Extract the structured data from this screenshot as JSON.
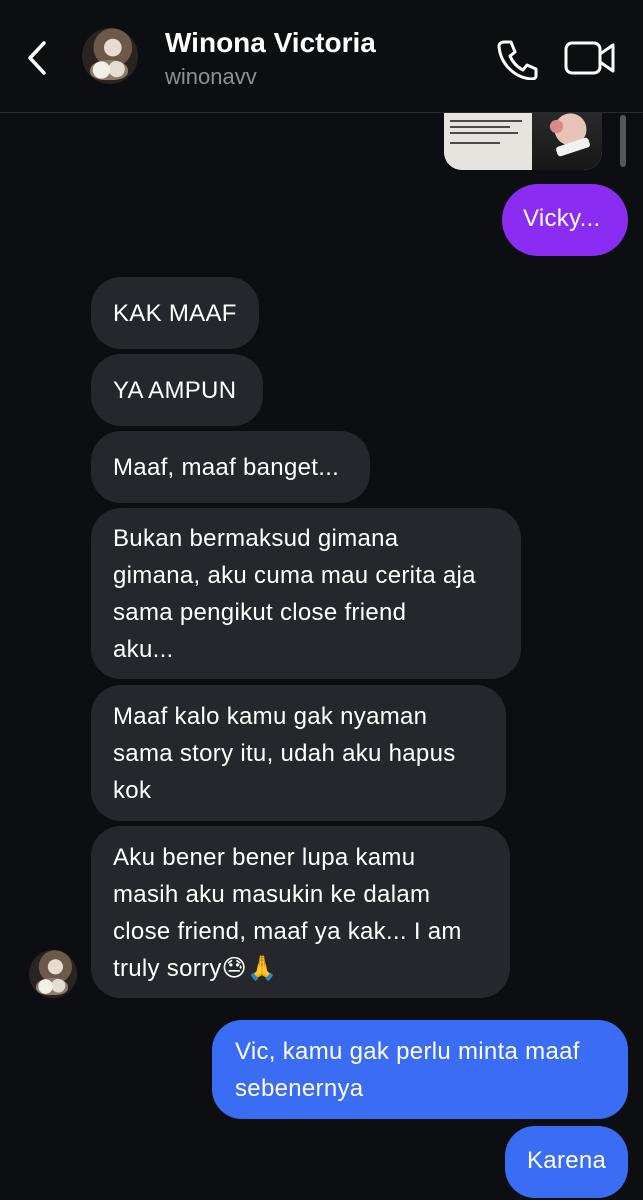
{
  "header": {
    "contact_name": "Winona Victoria",
    "username": "winonavv",
    "icons": {
      "back": "chevron-left-icon",
      "call": "phone-icon",
      "video": "video-camera-icon"
    }
  },
  "colors": {
    "background": "#0d0e12",
    "incoming_bubble": "#26272c",
    "outgoing_blue": "#3a6cf4",
    "outgoing_purple": "#8a2cf2",
    "username_gray": "#8e8f94"
  },
  "messages": [
    {
      "from": "me",
      "text": "Vicky..."
    },
    {
      "from": "them",
      "text": "KAK MAAF"
    },
    {
      "from": "them",
      "text": "YA AMPUN"
    },
    {
      "from": "them",
      "text": "Maaf, maaf banget..."
    },
    {
      "from": "them",
      "lines": [
        "Bukan bermaksud gimana",
        "gimana, aku cuma mau cerita aja",
        "sama pengikut close friend",
        "aku..."
      ]
    },
    {
      "from": "them",
      "lines": [
        "Maaf kalo kamu gak nyaman",
        "sama story itu, udah aku hapus",
        "kok"
      ]
    },
    {
      "from": "them",
      "lines": [
        "Aku bener bener lupa kamu",
        "masih aku masukin ke dalam",
        "close friend, maaf ya kak... I am",
        "truly sorry😓🙏"
      ]
    },
    {
      "from": "me",
      "lines": [
        "Vic, kamu gak perlu minta maaf",
        "sebenernya"
      ]
    },
    {
      "from": "me",
      "text": "Karena"
    }
  ]
}
